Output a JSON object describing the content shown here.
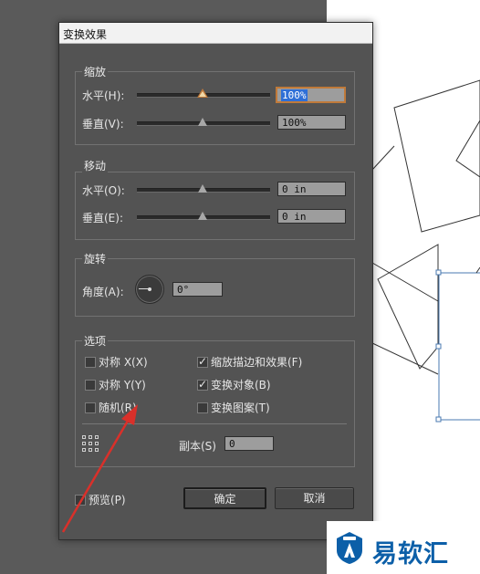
{
  "dialog": {
    "title": "变换效果"
  },
  "scale": {
    "title": "缩放",
    "horizontal": {
      "label": "水平(H):",
      "value": "100%"
    },
    "vertical": {
      "label": "垂直(V):",
      "value": "100%"
    }
  },
  "move": {
    "title": "移动",
    "horizontal": {
      "label": "水平(O):",
      "value": "0 in"
    },
    "vertical": {
      "label": "垂直(E):",
      "value": "0 in"
    }
  },
  "rotate": {
    "title": "旋转",
    "angle": {
      "label": "角度(A):",
      "value": "0°"
    }
  },
  "options": {
    "title": "选项",
    "reflect_x": {
      "label": "对称 X(X)",
      "checked": false
    },
    "reflect_y": {
      "label": "对称 Y(Y)",
      "checked": false
    },
    "random": {
      "label": "随机(R)",
      "checked": false
    },
    "scale_strokes": {
      "label": "缩放描边和效果(F)",
      "checked": true
    },
    "transform_objects": {
      "label": "变换对象(B)",
      "checked": true
    },
    "transform_patterns": {
      "label": "变换图案(T)",
      "checked": false
    },
    "copies": {
      "label": "副本(S)",
      "value": "0"
    }
  },
  "footer": {
    "preview": {
      "label": "预览(P)",
      "checked": false
    },
    "ok_label": "确定",
    "cancel_label": "取消"
  },
  "watermark": {
    "text": "易软汇"
  },
  "colors": {
    "accent": "#c07a3a",
    "selection": "#2f6fd6",
    "annotation_arrow": "#d9302a",
    "brand": "#0c5fa8"
  }
}
